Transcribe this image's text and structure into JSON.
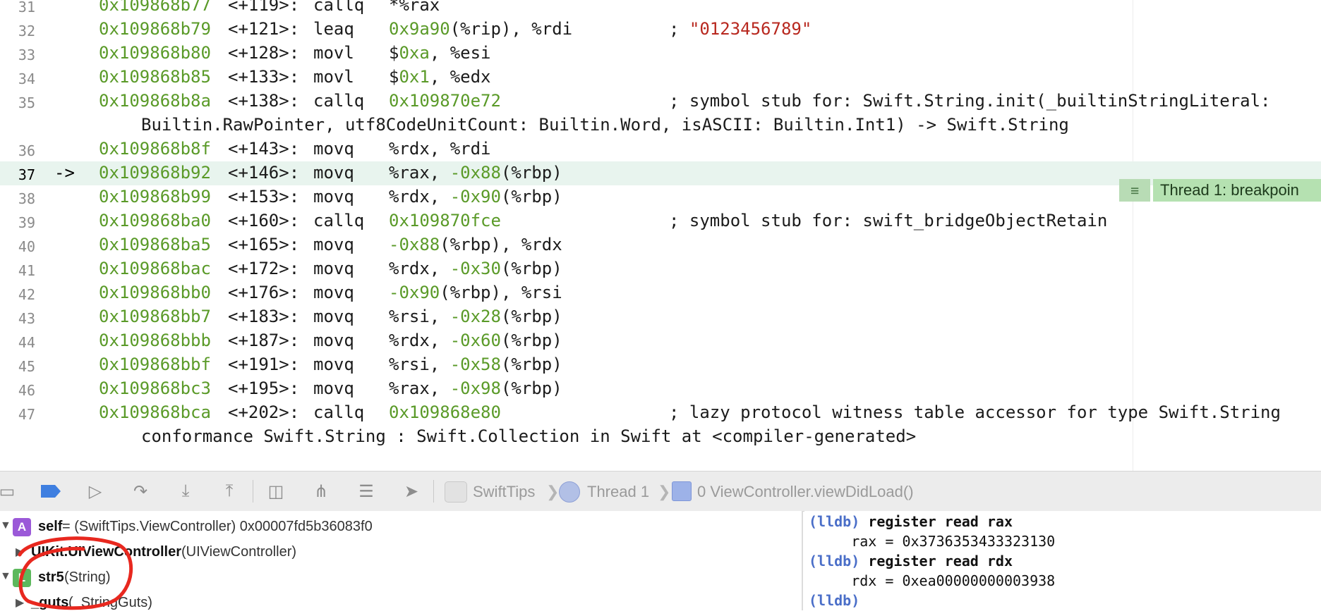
{
  "editor": {
    "current_arrow": "->",
    "lines": [
      {
        "n": "31",
        "addr": "0x109868b77",
        "off": "<+119>:",
        "mn": "callq",
        "ops": [
          {
            "t": "*%rax",
            "k": "p"
          }
        ],
        "comment": "",
        "cont": ""
      },
      {
        "n": "32",
        "addr": "0x109868b79",
        "off": "<+121>:",
        "mn": "leaq",
        "ops": [
          {
            "t": "0x9a90",
            "k": "n"
          },
          {
            "t": "(%rip), %rdi",
            "k": "p"
          }
        ],
        "comment": [
          {
            "t": "; ",
            "k": "p"
          },
          {
            "t": "\"0123456789\"",
            "k": "s"
          }
        ],
        "cont": ""
      },
      {
        "n": "33",
        "addr": "0x109868b80",
        "off": "<+128>:",
        "mn": "movl",
        "ops": [
          {
            "t": "$",
            "k": "p"
          },
          {
            "t": "0xa",
            "k": "n"
          },
          {
            "t": ", %esi",
            "k": "p"
          }
        ],
        "comment": "",
        "cont": ""
      },
      {
        "n": "34",
        "addr": "0x109868b85",
        "off": "<+133>:",
        "mn": "movl",
        "ops": [
          {
            "t": "$",
            "k": "p"
          },
          {
            "t": "0x1",
            "k": "n"
          },
          {
            "t": ", %edx",
            "k": "p"
          }
        ],
        "comment": "",
        "cont": ""
      },
      {
        "n": "35",
        "addr": "0x109868b8a",
        "off": "<+138>:",
        "mn": "callq",
        "ops": [
          {
            "t": "0x109870e72",
            "k": "n"
          }
        ],
        "comment": [
          {
            "t": "; symbol stub for: Swift.String.init(_builtinStringLiteral:",
            "k": "p"
          }
        ],
        "cont": "Builtin.RawPointer, utf8CodeUnitCount: Builtin.Word, isASCII: Builtin.Int1) -> Swift.String"
      },
      {
        "n": "36",
        "addr": "0x109868b8f",
        "off": "<+143>:",
        "mn": "movq",
        "ops": [
          {
            "t": "%rdx, %rdi",
            "k": "p"
          }
        ],
        "comment": "",
        "cont": ""
      },
      {
        "n": "37",
        "addr": "0x109868b92",
        "off": "<+146>:",
        "mn": "movq",
        "ops": [
          {
            "t": "%rax, ",
            "k": "p"
          },
          {
            "t": "-0x88",
            "k": "n"
          },
          {
            "t": "(%rbp)",
            "k": "p"
          }
        ],
        "comment": "",
        "cont": "",
        "current": true
      },
      {
        "n": "38",
        "addr": "0x109868b99",
        "off": "<+153>:",
        "mn": "movq",
        "ops": [
          {
            "t": "%rdx, ",
            "k": "p"
          },
          {
            "t": "-0x90",
            "k": "n"
          },
          {
            "t": "(%rbp)",
            "k": "p"
          }
        ],
        "comment": "",
        "cont": ""
      },
      {
        "n": "39",
        "addr": "0x109868ba0",
        "off": "<+160>:",
        "mn": "callq",
        "ops": [
          {
            "t": "0x109870fce",
            "k": "n"
          }
        ],
        "comment": [
          {
            "t": "; symbol stub for: swift_bridgeObjectRetain",
            "k": "p"
          }
        ],
        "cont": ""
      },
      {
        "n": "40",
        "addr": "0x109868ba5",
        "off": "<+165>:",
        "mn": "movq",
        "ops": [
          {
            "t": "-0x88",
            "k": "n"
          },
          {
            "t": "(%rbp), %rdx",
            "k": "p"
          }
        ],
        "comment": "",
        "cont": ""
      },
      {
        "n": "41",
        "addr": "0x109868bac",
        "off": "<+172>:",
        "mn": "movq",
        "ops": [
          {
            "t": "%rdx, ",
            "k": "p"
          },
          {
            "t": "-0x30",
            "k": "n"
          },
          {
            "t": "(%rbp)",
            "k": "p"
          }
        ],
        "comment": "",
        "cont": ""
      },
      {
        "n": "42",
        "addr": "0x109868bb0",
        "off": "<+176>:",
        "mn": "movq",
        "ops": [
          {
            "t": "-0x90",
            "k": "n"
          },
          {
            "t": "(%rbp), %rsi",
            "k": "p"
          }
        ],
        "comment": "",
        "cont": ""
      },
      {
        "n": "43",
        "addr": "0x109868bb7",
        "off": "<+183>:",
        "mn": "movq",
        "ops": [
          {
            "t": "%rsi, ",
            "k": "p"
          },
          {
            "t": "-0x28",
            "k": "n"
          },
          {
            "t": "(%rbp)",
            "k": "p"
          }
        ],
        "comment": "",
        "cont": ""
      },
      {
        "n": "44",
        "addr": "0x109868bbb",
        "off": "<+187>:",
        "mn": "movq",
        "ops": [
          {
            "t": "%rdx, ",
            "k": "p"
          },
          {
            "t": "-0x60",
            "k": "n"
          },
          {
            "t": "(%rbp)",
            "k": "p"
          }
        ],
        "comment": "",
        "cont": ""
      },
      {
        "n": "45",
        "addr": "0x109868bbf",
        "off": "<+191>:",
        "mn": "movq",
        "ops": [
          {
            "t": "%rsi, ",
            "k": "p"
          },
          {
            "t": "-0x58",
            "k": "n"
          },
          {
            "t": "(%rbp)",
            "k": "p"
          }
        ],
        "comment": "",
        "cont": ""
      },
      {
        "n": "46",
        "addr": "0x109868bc3",
        "off": "<+195>:",
        "mn": "movq",
        "ops": [
          {
            "t": "%rax, ",
            "k": "p"
          },
          {
            "t": "-0x98",
            "k": "n"
          },
          {
            "t": "(%rbp)",
            "k": "p"
          }
        ],
        "comment": "",
        "cont": ""
      },
      {
        "n": "47",
        "addr": "0x109868bca",
        "off": "<+202>:",
        "mn": "callq",
        "ops": [
          {
            "t": "0x109868e80",
            "k": "n"
          }
        ],
        "comment": [
          {
            "t": "; lazy protocol witness table accessor for type Swift.String",
            "k": "p"
          }
        ],
        "cont": "conformance Swift.String : Swift.Collection in Swift at <compiler-generated>"
      }
    ]
  },
  "breakpoint": {
    "label": "Thread 1: breakpoin",
    "icon": "list-icon",
    "color": "#b5e1b1"
  },
  "debugbar": {
    "breadcrumbs": {
      "app": "SwiftTips",
      "thread": "Thread 1",
      "frame": "0 ViewController.viewDidLoad()"
    },
    "buttons": [
      "hide-debug-area",
      "breakpoints-toggle",
      "continue",
      "step-over",
      "step-into",
      "step-out",
      "view-hierarchy",
      "memory-graph",
      "environment-overrides",
      "simulate-location"
    ]
  },
  "variables": [
    {
      "indent": 0,
      "expanded": true,
      "badge": "A",
      "badge_color": "#9b59d8",
      "name": "self",
      "type_text": " = (SwiftTips.ViewController) 0x00007fd5b36083f0"
    },
    {
      "indent": 1,
      "expanded": false,
      "badge": "",
      "badge_color": "",
      "name": "UIKit.UIViewController",
      "type_text": " (UIViewController)"
    },
    {
      "indent": 0,
      "expanded": true,
      "badge": "L",
      "badge_color": "#5cb85c",
      "name": "str5",
      "type_text": " (String)"
    },
    {
      "indent": 1,
      "expanded": false,
      "badge": "",
      "badge_color": "",
      "name": "_guts",
      "type_text": " (_StringGuts)"
    }
  ],
  "console": {
    "lines": [
      {
        "prompt": "(lldb)",
        "text": " register read rax",
        "kind": "cmd"
      },
      {
        "prompt": "",
        "text": "     rax = 0x3736353433323130",
        "kind": "out"
      },
      {
        "prompt": "(lldb)",
        "text": " register read rdx",
        "kind": "cmd"
      },
      {
        "prompt": "",
        "text": "     rdx = 0xea00000000003938",
        "kind": "out"
      },
      {
        "prompt": "(lldb)",
        "text": "",
        "kind": "cmd"
      }
    ]
  },
  "annotation_color": "#e8281f"
}
